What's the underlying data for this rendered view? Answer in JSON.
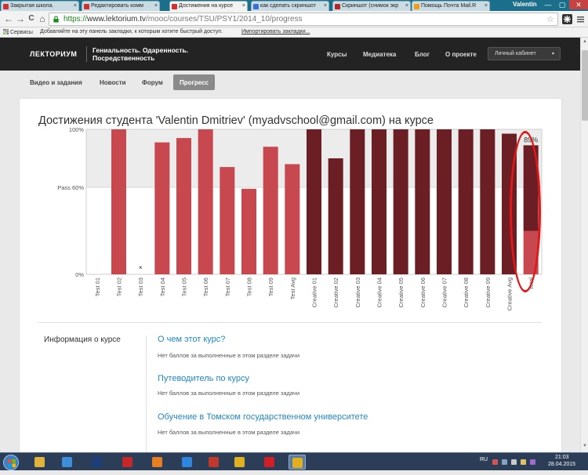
{
  "browser": {
    "tabs": [
      {
        "label": "Закрытая школа. ",
        "favicon_color": "#d32f2f"
      },
      {
        "label": "Редактировать комм",
        "favicon_color": "#d32f2f"
      },
      {
        "label": "Достижения на курсе",
        "favicon_color": "#d32f2f"
      },
      {
        "label": "как сделать скриншот",
        "favicon_color": "#3a6fd8"
      },
      {
        "label": "Скриншот (снимок экр",
        "favicon_color": "#b42828"
      },
      {
        "label": "Помощь Почта Mail.R",
        "favicon_color": "#f39c12"
      }
    ],
    "user": "Valentin",
    "window_controls": [
      "—",
      "▢",
      "✕"
    ],
    "back": "←",
    "forward": "→",
    "reload": "C",
    "home": "⌂",
    "url_scheme": "https://",
    "url_host": "www.lektorium.tv",
    "url_path": "/mooc/courses/TSU/PSY1/2014_10/progress",
    "star": "☆",
    "bookmarks": {
      "apps": "Сервисы",
      "hint": "Добавляйте на эту панель закладки, к которым хотите быстрый доступ.",
      "import": "Импортировать закладки..."
    }
  },
  "site": {
    "logo": "ЛЕКТОРИУМ",
    "course_title_line1": "Гениальность. Одаренность.",
    "course_title_line2": "Посредственность",
    "nav": [
      "Курсы",
      "Медиатека",
      "Блог",
      "О проекте"
    ],
    "cabinet": "Личный кабинет",
    "cabinet_caret": "▾"
  },
  "course_nav": {
    "items": [
      "Видео и задания",
      "Новости",
      "Форум",
      "Прогресс"
    ],
    "active": "Прогресс"
  },
  "page": {
    "title": "Достижения студента 'Valentin Dmitriev' (myadvschool@gmail.com) на курсе"
  },
  "chart_data": {
    "type": "bar",
    "ylim": [
      0,
      100
    ],
    "y_ticks": [
      {
        "value": 0,
        "label": "0%"
      },
      {
        "value": 60,
        "label": "Pass 60%"
      },
      {
        "value": 100,
        "label": "100%"
      }
    ],
    "pass_threshold": 60,
    "categories": [
      "Test 01",
      "Test 02",
      "Test 03",
      "Test 04",
      "Test 05",
      "Test 06",
      "Test 07",
      "Test 08",
      "Test 09",
      "Test Avg",
      "Creative 01",
      "Creative 02",
      "Creative 03",
      "Creative 04",
      "Creative 05",
      "Creative 06",
      "Creative 07",
      "Creative 08",
      "Creative 09",
      "Creative Avg",
      "Total"
    ],
    "values": [
      0,
      100,
      0,
      91,
      94,
      100,
      74,
      59,
      88,
      76,
      100,
      80,
      100,
      100,
      100,
      100,
      100,
      100,
      100,
      97,
      89
    ],
    "series_kind": [
      "test",
      "test",
      "test",
      "test",
      "test",
      "test",
      "test",
      "test",
      "test",
      "test",
      "creative",
      "creative",
      "creative",
      "creative",
      "creative",
      "creative",
      "creative",
      "creative",
      "creative",
      "creative",
      "total"
    ],
    "total_breakdown": {
      "test_part": 30,
      "creative_part": 59
    },
    "total_label": "89%",
    "dropped_marker": {
      "category": "Test 03",
      "symbol": "×"
    },
    "colors": {
      "test": "#c8484f",
      "creative": "#6b1f25",
      "pass_band": "#ececec",
      "total_test": "#c8484f",
      "total_creative": "#6b1f25"
    }
  },
  "annotation": {
    "color": "#e01818"
  },
  "info": {
    "label": "Информация о курсе",
    "items": [
      {
        "title": "О чем этот курс?",
        "desc": "Нет баллов за выполненные в этом разделе задачи"
      },
      {
        "title": "Путеводитель по курсу",
        "desc": "Нет баллов за выполненные в этом разделе задачи"
      },
      {
        "title": "Обучение в Томском государственном университете",
        "desc": "Нет баллов за выполненные в этом разделе задачи"
      }
    ]
  },
  "taskbar": {
    "apps": [
      {
        "name": "explorer-icon",
        "color": "#e2b33a"
      },
      {
        "name": "ie-icon",
        "color": "#3c8fd8"
      },
      {
        "name": "photoshop-icon",
        "color": "#1c3f7a"
      },
      {
        "name": "app-red-icon",
        "color": "#c62828"
      },
      {
        "name": "media-icon",
        "color": "#e67e22"
      },
      {
        "name": "globe-icon",
        "color": "#2e86de"
      },
      {
        "name": "kaspersky-icon",
        "color": "#c0392b"
      },
      {
        "name": "chrome-icon",
        "color": "#e0b020"
      },
      {
        "name": "opera-icon",
        "color": "#d21f26"
      },
      {
        "name": "chrome-active-icon",
        "color": "#e0b020"
      }
    ],
    "lang": "RU",
    "time": "21:03",
    "date": "28.04.2015"
  }
}
